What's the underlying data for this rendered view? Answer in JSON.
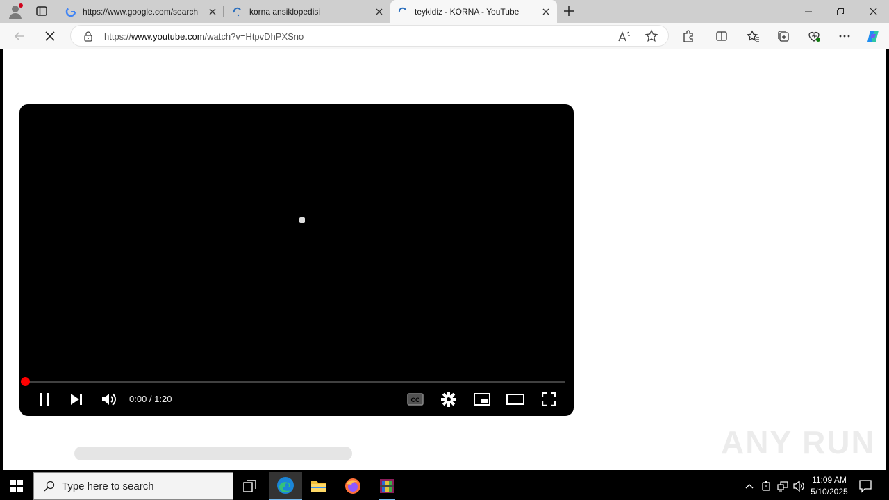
{
  "browser": {
    "tabs": [
      {
        "title": "https://www.google.com/search",
        "favicon": "google-icon",
        "active": false
      },
      {
        "title": "korna ansiklopedisi",
        "favicon": "loading-icon",
        "active": false
      },
      {
        "title": "teykidiz - KORNA - YouTube",
        "favicon": "loading-icon",
        "active": true
      }
    ],
    "address": {
      "scheme": "https://",
      "host": "www.youtube.com",
      "path": "/watch?v=HtpvDhPXSno"
    }
  },
  "player": {
    "time_current": "0:00",
    "time_separator": " / ",
    "time_total": "1:20",
    "progress_fraction": 0.0,
    "state": "playing",
    "accent_color": "#ff0000"
  },
  "watermark": "ANY RUN",
  "taskbar": {
    "search_placeholder": "Type here to search",
    "clock_time": "11:09 AM",
    "clock_date": "5/10/2025",
    "apps": [
      "task-view",
      "edge",
      "file-explorer",
      "firefox",
      "winrar"
    ]
  }
}
